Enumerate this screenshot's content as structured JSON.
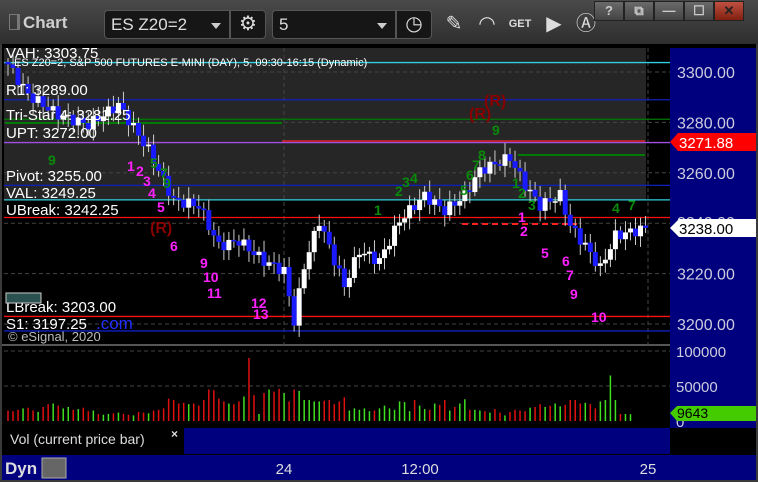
{
  "window": {
    "title": "Chart",
    "symbol": "ES Z20=2",
    "interval": "5",
    "buttons": {
      "help": "?",
      "restore": "⧉",
      "minimize": "—",
      "maximize": "☐",
      "close": "✕"
    }
  },
  "toolbar": {
    "icons": [
      "link-icon",
      "clock-icon",
      "pencil-icon",
      "study-icon",
      "get-icon",
      "play-icon",
      "alert-icon"
    ],
    "get_label": "GET"
  },
  "chart": {
    "header": "ES Z20=2, S&P 500 FUTURES E-MINI (DAY), 5, 09:30-16:15 (Dynamic)",
    "copyright": "© eSignal, 2020",
    "levels": [
      {
        "label": "VAH: 3303.75",
        "price": 3303.75,
        "color": "#30d0e0"
      },
      {
        "label": "R1: 3289.00",
        "price": 3289.0,
        "color": "#1020c0"
      },
      {
        "label": "Tri-Star 4: 3281.25",
        "price": 3281.25,
        "color": "#007a00"
      },
      {
        "label": "UPT: 3272.00",
        "price": 3272.0,
        "color": "#a050e0"
      },
      {
        "label": "Pivot: 3255.00",
        "price": 3255.0,
        "color": "#1020c0"
      },
      {
        "label": "VAL: 3249.25",
        "price": 3249.25,
        "color": "#30d0e0"
      },
      {
        "label": "UBreak: 3242.25",
        "price": 3242.25,
        "color": "#ff1010"
      },
      {
        "label": "LBreak: 3203.00",
        "price": 3203.0,
        "color": "#ff1010"
      },
      {
        "label": "S1: 3197.25",
        "price": 3197.25,
        "color": "#1020c0"
      }
    ],
    "com_text": ".com",
    "markers": {
      "r": "(R)",
      "magenta_counts": [
        "1",
        "2",
        "3",
        "4",
        "5",
        "6",
        "9",
        "10",
        "11",
        "12",
        "13",
        "1",
        "2",
        "5",
        "6",
        "7",
        "9",
        "10"
      ],
      "green_counts": [
        "9",
        "5",
        "7",
        "9",
        "1",
        "2",
        "3",
        "4",
        "5",
        "6",
        "7",
        "8",
        "9",
        "1",
        "2",
        "3",
        "4",
        "7"
      ]
    },
    "last_price": "3238.00",
    "upt_tag": "3271.88",
    "price_ticks": [
      "3300.00",
      "3280.00",
      "3260.00",
      "3240.00",
      "3220.00",
      "3200.00"
    ],
    "vol_ticks": [
      "100000",
      "50000",
      "0"
    ],
    "vol_last": "9643",
    "vol_legend": "Vol (current price bar)",
    "vol_close": "×",
    "x_ticks": [
      "24",
      "12:00",
      "25"
    ],
    "dyn_label": "Dyn",
    "colors": {
      "up": "#ffffff",
      "down": "#1a1aff",
      "vol_up": "#40e020",
      "vol_down": "#e01010",
      "axis_bg": "#00007f",
      "last_tag": "#ffffff",
      "upt_tag": "#ff0000",
      "vol_tag": "#44cc00"
    }
  },
  "chart_data": {
    "type": "candlestick",
    "close_path": [
      [
        0,
        3303
      ],
      [
        4,
        3291
      ],
      [
        10,
        3283
      ],
      [
        16,
        3279
      ],
      [
        22,
        3287
      ],
      [
        28,
        3269
      ],
      [
        33,
        3249
      ],
      [
        38,
        3247
      ],
      [
        42,
        3231
      ],
      [
        46,
        3233
      ],
      [
        51,
        3225
      ],
      [
        55,
        3221
      ],
      [
        57,
        3201
      ],
      [
        59,
        3223
      ],
      [
        62,
        3241
      ],
      [
        67,
        3215
      ],
      [
        70,
        3229
      ],
      [
        74,
        3225
      ],
      [
        78,
        3241
      ],
      [
        83,
        3251
      ],
      [
        87,
        3245
      ],
      [
        91,
        3251
      ],
      [
        94,
        3261
      ],
      [
        100,
        3266
      ],
      [
        103,
        3255
      ],
      [
        106,
        3247
      ],
      [
        110,
        3251
      ],
      [
        112,
        3239
      ],
      [
        115,
        3231
      ],
      [
        118,
        3222
      ],
      [
        121,
        3235
      ],
      [
        127,
        3238
      ]
    ],
    "ylim": [
      3195,
      3310
    ],
    "volume": [
      15000,
      14000,
      16000,
      18000,
      19000,
      15000,
      13000,
      20000,
      24000,
      25000,
      22000,
      18000,
      20000,
      16000,
      17000,
      19000,
      14000,
      15000,
      10000,
      9000,
      10000,
      11000,
      12000,
      10000,
      9000,
      8000,
      13000,
      12000,
      11000,
      15000,
      16000,
      18000,
      32000,
      30000,
      25000,
      26000,
      24000,
      25000,
      22000,
      30000,
      45000,
      44000,
      32000,
      28000,
      25000,
      24000,
      28000,
      35000,
      90000,
      37000,
      10000,
      40000,
      45000,
      42000,
      46000,
      40000,
      28000,
      45000,
      43000,
      30000,
      30000,
      28000,
      28000,
      29000,
      30000,
      24000,
      28000,
      34000,
      15000,
      18000,
      16000,
      18000,
      14000,
      15000,
      18000,
      22000,
      18000,
      16000,
      28000,
      27000,
      14000,
      30000,
      22000,
      17000,
      16000,
      25000,
      23000,
      30000,
      15000,
      20000,
      25000,
      31000,
      16000,
      16000,
      15000,
      14000,
      12000,
      17000,
      12000,
      8000,
      13000,
      16000,
      15000,
      14000,
      19000,
      20000,
      24000,
      20000,
      22000,
      25000,
      21000,
      23000,
      30000,
      30000,
      25000,
      26000,
      24000,
      18000,
      28000,
      30000,
      65000,
      30000,
      10000,
      10000,
      9643
    ],
    "xticks": [
      "24",
      "12:00",
      "25"
    ],
    "vol_ylim": [
      0,
      100000
    ]
  }
}
